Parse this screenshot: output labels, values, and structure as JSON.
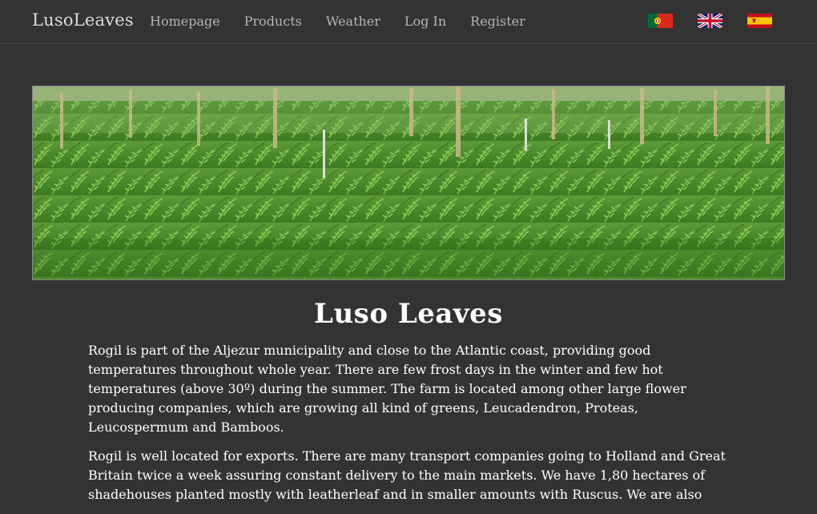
{
  "navbar": {
    "brand": "LusoLeaves",
    "links": [
      "Homepage",
      "Products",
      "Weather",
      "Log In",
      "Register"
    ],
    "flags": [
      "portugal-flag-icon",
      "uk-flag-icon",
      "spain-flag-icon"
    ]
  },
  "main": {
    "title": "Luso Leaves",
    "paragraphs": [
      "Rogil is part of the Aljezur municipality and close to the Atlantic coast, providing good temperatures throughout whole year. There are few frost days in the winter and few hot temperatures (above 30º) during the summer. The farm is located among other large flower producing companies, which are growing all kind of greens, Leucadendron, Proteas, Leucospermum and Bamboos.",
      "Rogil is well located for exports. There are many transport companies going to Holland and Great Britain twice a week assuring constant delivery to the main markets. We have 1,80 hectares of shadehouses planted mostly with leatherleaf and in smaller amounts with Ruscus. We are also"
    ]
  },
  "colors": {
    "background": "#333333",
    "nav_text": "#b5b5b5",
    "brand_text": "#dcdcdc",
    "foliage": "#4e8a2e"
  }
}
